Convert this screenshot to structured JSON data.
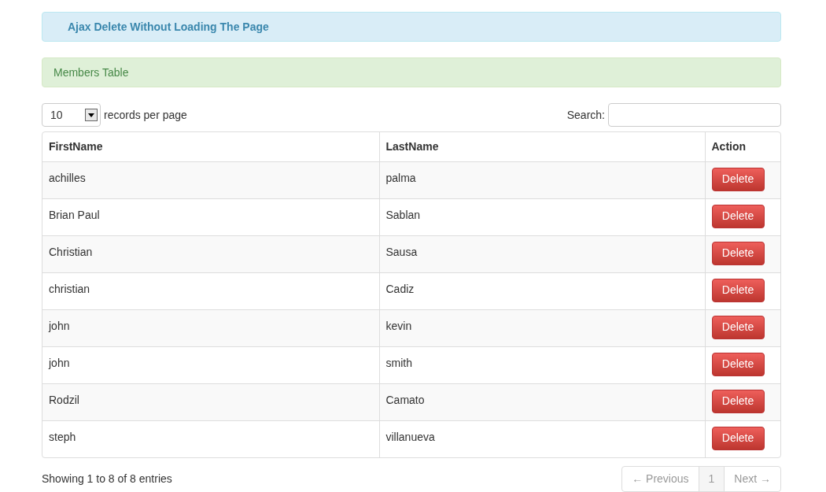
{
  "header_alert": {
    "text": "Ajax Delete Without Loading The Page"
  },
  "panel_alert": {
    "text": "Members Table"
  },
  "length_control": {
    "value": "10",
    "label": "records per page"
  },
  "search": {
    "label": "Search:"
  },
  "table": {
    "columns": [
      "FirstName",
      "LastName",
      "Action"
    ],
    "rows": [
      {
        "first": "achilles",
        "last": "palma",
        "action": "Delete"
      },
      {
        "first": "Brian Paul",
        "last": "Sablan",
        "action": "Delete"
      },
      {
        "first": "Christian",
        "last": "Sausa",
        "action": "Delete"
      },
      {
        "first": "christian",
        "last": "Cadiz",
        "action": "Delete"
      },
      {
        "first": "john",
        "last": "kevin",
        "action": "Delete"
      },
      {
        "first": "john",
        "last": "smith",
        "action": "Delete"
      },
      {
        "first": "Rodzil",
        "last": "Camato",
        "action": "Delete"
      },
      {
        "first": "steph",
        "last": "villanueva",
        "action": "Delete"
      }
    ]
  },
  "info": "Showing 1 to 8 of 8 entries",
  "pagination": {
    "previous": {
      "label": "← Previous",
      "disabled": true
    },
    "pages": [
      {
        "label": "1",
        "selected": true
      }
    ],
    "next": {
      "label": "Next →",
      "disabled": true
    }
  }
}
